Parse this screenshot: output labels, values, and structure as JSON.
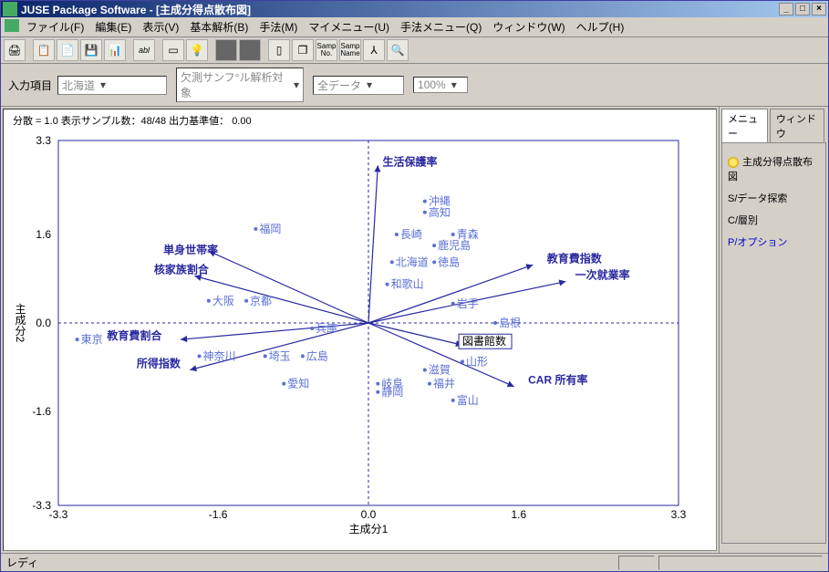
{
  "title": "JUSE Package Software - [主成分得点散布図]",
  "menus": [
    "ファイル(F)",
    "編集(E)",
    "表示(V)",
    "基本解析(B)",
    "手法(M)",
    "マイメニュー(U)",
    "手法メニュー(Q)",
    "ウィンドウ(W)",
    "ヘルプ(H)"
  ],
  "params": {
    "label": "入力項目",
    "c1": "北海道",
    "c2": "欠測サンフ°ル解析対象",
    "c3": "全データ",
    "c4": "100%"
  },
  "chartheader": "分散 = 1.0     表示サンプル数：48/48     出力基準値： 0.00",
  "sidepanel": {
    "tabs": [
      "メニュー",
      "ウィンドウ"
    ],
    "items": [
      {
        "text": "主成分得点散布図",
        "bulb": true
      },
      {
        "text": "S/データ探索"
      },
      {
        "text": "C/層別"
      },
      {
        "text": "P/オプション",
        "link": true
      }
    ]
  },
  "status": "レディ",
  "chart_data": {
    "type": "scatter",
    "title": "主成分得点散布図",
    "xlabel": "主成分1",
    "ylabel": "主成分2",
    "xlim": [
      -3.3,
      3.3
    ],
    "ylim": [
      -3.3,
      3.3
    ],
    "ticks": [
      -3.3,
      -1.6,
      0.0,
      1.6,
      3.3
    ],
    "points": [
      {
        "label": "沖縄",
        "x": 0.6,
        "y": 2.2
      },
      {
        "label": "高知",
        "x": 0.6,
        "y": 2.0
      },
      {
        "label": "福岡",
        "x": -1.2,
        "y": 1.7
      },
      {
        "label": "長崎",
        "x": 0.3,
        "y": 1.6
      },
      {
        "label": "青森",
        "x": 0.9,
        "y": 1.6
      },
      {
        "label": "鹿児島",
        "x": 0.7,
        "y": 1.4
      },
      {
        "label": "単身世帯率",
        "vec": true,
        "x": -1.6,
        "y": 1.25
      },
      {
        "label": "北海道",
        "x": 0.25,
        "y": 1.1
      },
      {
        "label": "徳島",
        "x": 0.7,
        "y": 1.1
      },
      {
        "label": "核家族割合",
        "vec": true,
        "x": -1.7,
        "y": 0.9
      },
      {
        "label": "教育費指数",
        "vec": true,
        "x": 1.9,
        "y": 1.1
      },
      {
        "label": "和歌山",
        "x": 0.2,
        "y": 0.7
      },
      {
        "label": "一次就業率",
        "vec": true,
        "x": 2.2,
        "y": 0.8
      },
      {
        "label": "大阪",
        "x": -1.7,
        "y": 0.4
      },
      {
        "label": "京都",
        "x": -1.3,
        "y": 0.4
      },
      {
        "label": "岩手",
        "x": 0.9,
        "y": 0.35
      },
      {
        "label": "島根",
        "x": 1.35,
        "y": 0.0
      },
      {
        "label": "東京",
        "x": -3.1,
        "y": -0.3
      },
      {
        "label": "教育費割合",
        "vec": true,
        "x": -2.2,
        "y": -0.3
      },
      {
        "label": "兵庫",
        "x": -0.6,
        "y": -0.1
      },
      {
        "label": "図書館数",
        "box": true,
        "x": 1.0,
        "y": -0.4
      },
      {
        "label": "神奈川",
        "x": -1.8,
        "y": -0.6
      },
      {
        "label": "埼玉",
        "x": -1.1,
        "y": -0.6
      },
      {
        "label": "広島",
        "x": -0.7,
        "y": -0.6
      },
      {
        "label": "山形",
        "x": 1.0,
        "y": -0.7
      },
      {
        "label": "所得指数",
        "vec": true,
        "x": -2.0,
        "y": -0.8
      },
      {
        "label": "滋賀",
        "x": 0.6,
        "y": -0.85
      },
      {
        "label": "愛知",
        "x": -0.9,
        "y": -1.1
      },
      {
        "label": "岐阜",
        "x": 0.1,
        "y": -1.1
      },
      {
        "label": "福井",
        "x": 0.65,
        "y": -1.1
      },
      {
        "label": "静岡",
        "x": 0.1,
        "y": -1.25
      },
      {
        "label": "CAR 所有率",
        "vec": true,
        "x": 1.7,
        "y": -1.1
      },
      {
        "label": "富山",
        "x": 0.9,
        "y": -1.4
      },
      {
        "label": "生活保護率",
        "vec": true,
        "x": 0.15,
        "y": 2.85
      }
    ],
    "vectors": [
      {
        "x": -1.7,
        "y": 1.3
      },
      {
        "x": -1.85,
        "y": 0.85
      },
      {
        "x": 1.75,
        "y": 1.05
      },
      {
        "x": 2.1,
        "y": 0.75
      },
      {
        "x": -2.0,
        "y": -0.3
      },
      {
        "x": -1.9,
        "y": -0.85
      },
      {
        "x": 1.55,
        "y": -1.15
      },
      {
        "x": 0.1,
        "y": 2.85
      },
      {
        "x": 1.0,
        "y": -0.4
      }
    ]
  }
}
